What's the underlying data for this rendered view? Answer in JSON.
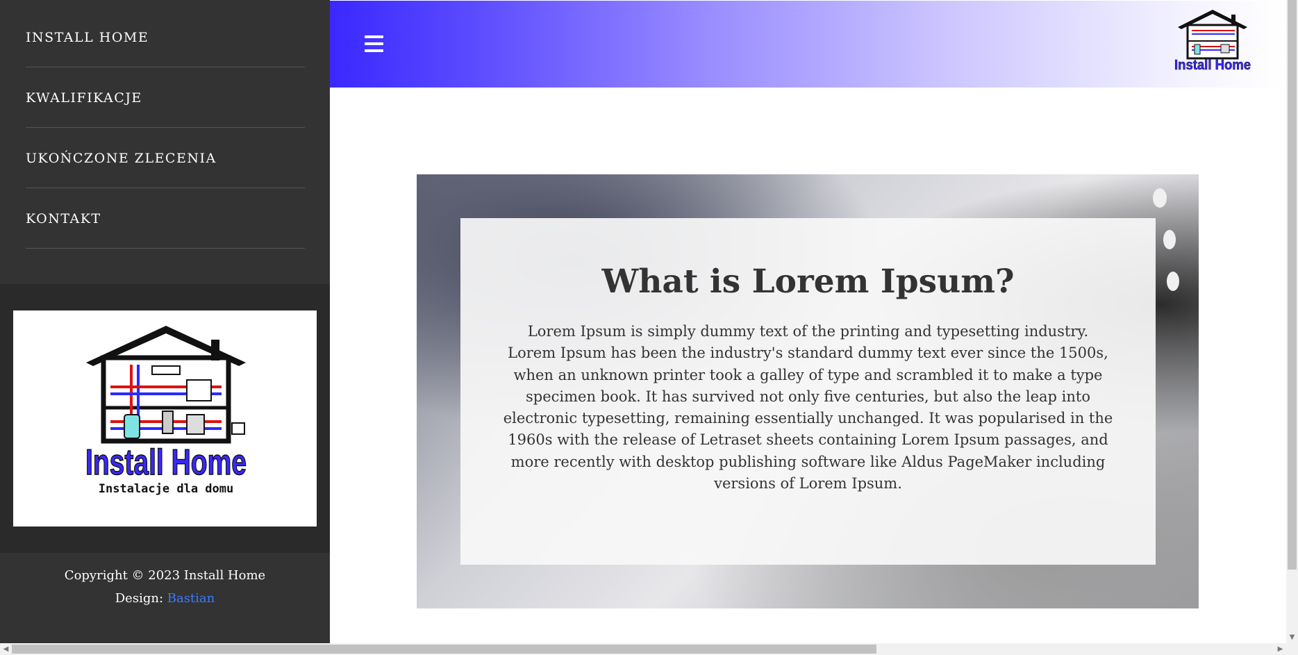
{
  "sidebar": {
    "nav_items": [
      {
        "label": "INSTALL HOME"
      },
      {
        "label": "KWALIFIKACJE"
      },
      {
        "label": "UKOŃCZONE ZLECENIA"
      },
      {
        "label": "KONTAKT"
      }
    ],
    "logo": {
      "brand": "Install Home",
      "tagline": "Instalacje dla domu"
    },
    "copyright": "Copyright © 2023 Install Home",
    "design_prefix": "Design: ",
    "design_author": "Bastian"
  },
  "header": {
    "menu_icon": "hamburger-menu-icon",
    "logo_text": "Install Home"
  },
  "main": {
    "title": "What is Lorem Ipsum?",
    "body": "Lorem Ipsum is simply dummy text of the printing and typesetting industry. Lorem Ipsum has been the industry's standard dummy text ever since the 1500s, when an unknown printer took a galley of type and scrambled it to make a type specimen book. It has survived not only five centuries, but also the leap into electronic typesetting, remaining essentially unchanged. It was popularised in the 1960s with the release of Letraset sheets containing Lorem Ipsum passages, and more recently with desktop publishing software like Aldus PageMaker including versions of Lorem Ipsum."
  },
  "colors": {
    "sidebar_bg": "#333333",
    "logo_band_bg": "#2a2a2a",
    "brand_blue": "#3a28ff",
    "link_blue": "#3a7bff"
  }
}
